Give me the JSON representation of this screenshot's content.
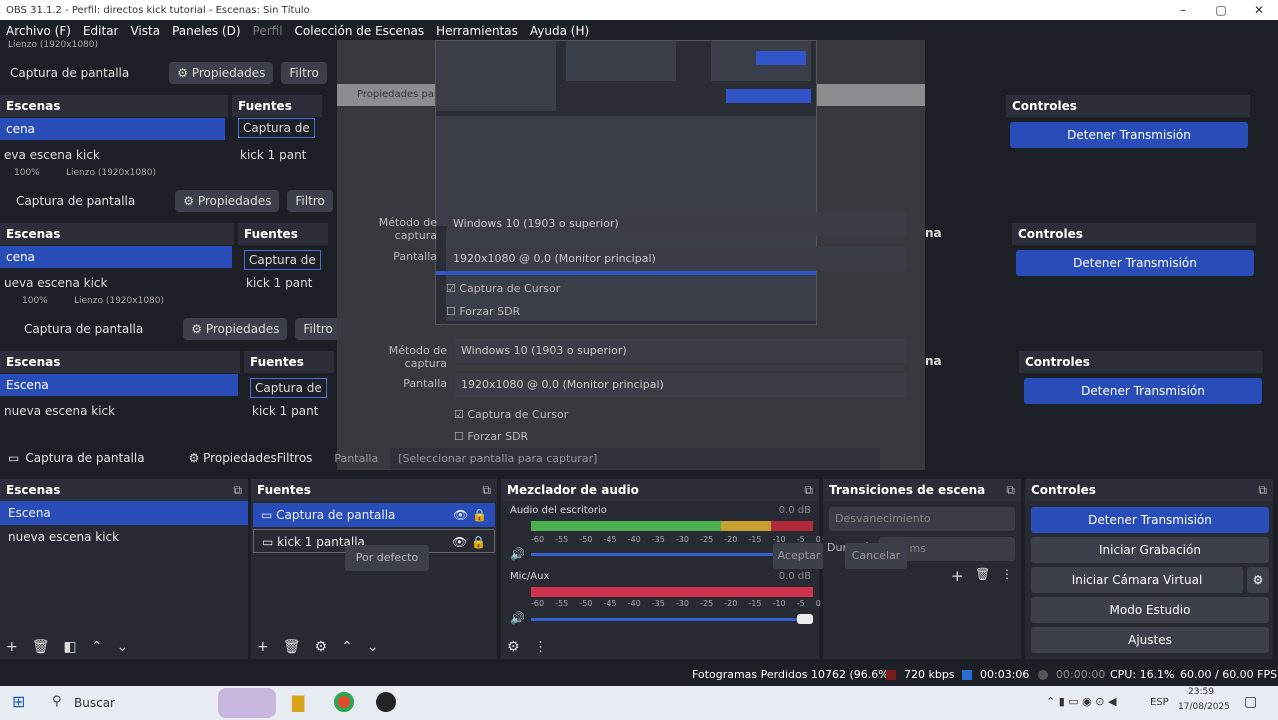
{
  "window": {
    "title": "OBS 31.1.2 - Perfil: directos kick tutorial - Escenas: Sin Título"
  },
  "menu": [
    "Archivo (F)",
    "Editar",
    "Vista",
    "Paneles (D)",
    "Perfil",
    "Colección de Escenas",
    "Herramientas",
    "Ayuda (H)"
  ],
  "source_bar": {
    "source": "Captura de pantalla",
    "properties": "Propiedades",
    "filters": "Filtros",
    "filters_short": "Filtro",
    "screen_label": "Pantalla",
    "screen_value": "[Seleccionar pantalla para capturar]"
  },
  "canvas": {
    "zoom": "100%",
    "size": "Lienzo (1920x1080)"
  },
  "scenes": {
    "title": "Escenas",
    "items": [
      "Escena",
      "nueva escena kick"
    ],
    "ghost_short": [
      "cena",
      "eva escena kick",
      "ueva escena kick"
    ]
  },
  "sources": {
    "title": "Fuentes",
    "items": [
      "Captura de pantalla",
      "kick 1 pantalla"
    ],
    "short": [
      "Captura de",
      "kick 1 pant"
    ]
  },
  "mixer": {
    "title": "Mezclador de audio",
    "ch1": "Audio del escritorio",
    "ch1_db": "0.0 dB",
    "ch2": "Mic/Aux",
    "ch2_db": "0.0 dB",
    "ticks": [
      "-60",
      "-55",
      "-50",
      "-45",
      "-40",
      "-35",
      "-30",
      "-25",
      "-20",
      "-15",
      "-10",
      "-5",
      "0"
    ]
  },
  "transitions": {
    "title": "Transiciones de escena",
    "short": "na",
    "type": "Desvanecimiento",
    "duration_label": "Duración",
    "duration": "300 ms"
  },
  "controls": {
    "title": "Controles",
    "stop_stream": "Detener Transmisión",
    "start_rec": "Iniciar Grabación",
    "virtual_cam": "Iniciar Cámara Virtual",
    "studio": "Modo Estudio",
    "settings": "Ajustes"
  },
  "dialog": {
    "title": "Propiedades para 'Captura de pantalla'",
    "capture_method_label": "Método de captura",
    "capture_method": "Windows 10 (1903 o superior)",
    "screen_label": "Pantalla",
    "screen": "1920x1080 @ 0,0 (Monitor principal)",
    "cursor": "Captura de Cursor",
    "sdr": "Forzar SDR",
    "defaults": "Por defecto",
    "ok": "Aceptar",
    "cancel": "Cancelar"
  },
  "status": {
    "dropped": "Fotogramas Perdidos 10762 (96.6%)",
    "bitrate": "720 kbps",
    "stream_time": "00:03:06",
    "rec_time": "00:00:00",
    "cpu": "CPU: 16.1%",
    "fps": "60.00 / 60.00 FPS"
  },
  "taskbar": {
    "search": "Buscar",
    "lang": "ESP",
    "time": "23:59",
    "date": "17/08/2025"
  }
}
